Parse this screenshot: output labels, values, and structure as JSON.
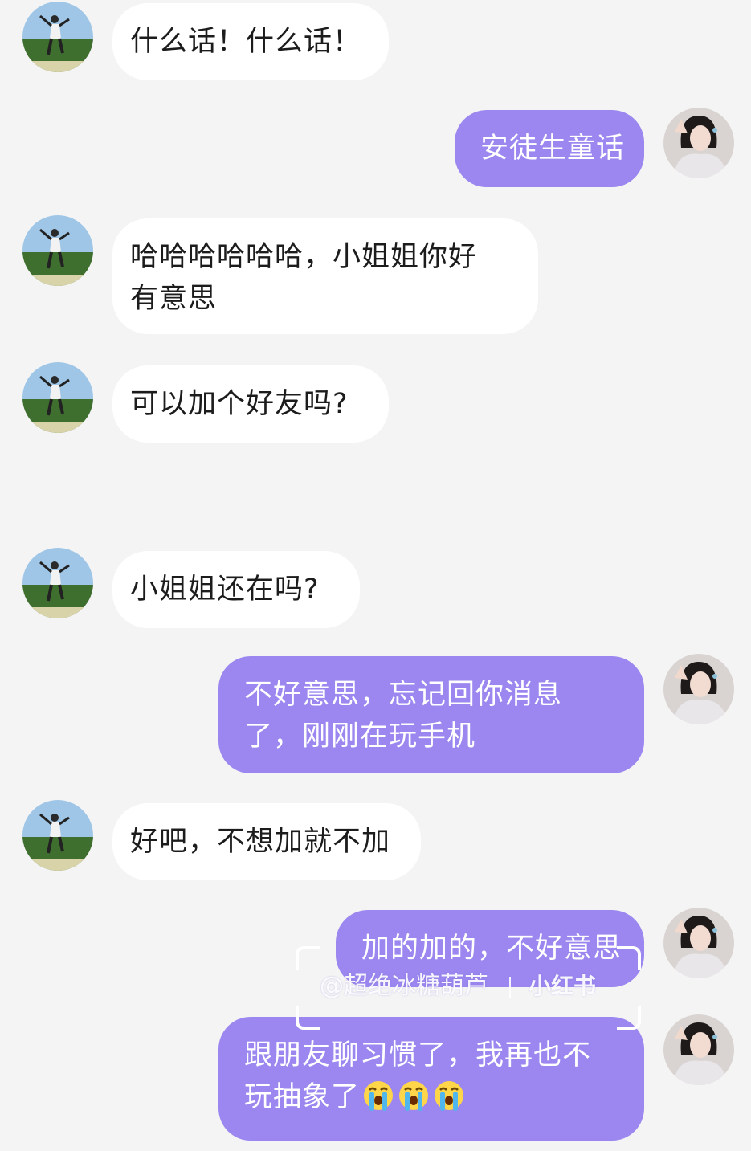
{
  "colors": {
    "background": "#f4f4f5",
    "incoming_bubble": "#ffffff",
    "outgoing_bubble": "#9b87ef",
    "incoming_text": "#1c1c1c",
    "outgoing_text": "#ffffff"
  },
  "messages": [
    {
      "sender": "other",
      "avatar_icon": "field-boy-avatar-icon",
      "text": "什么话！什么话！"
    },
    {
      "sender": "me",
      "avatar_icon": "girl-selfie-avatar-icon",
      "text": "安徒生童话"
    },
    {
      "sender": "other",
      "avatar_icon": "field-boy-avatar-icon",
      "text": "哈哈哈哈哈哈，小姐姐你好\n有意思"
    },
    {
      "sender": "other",
      "avatar_icon": "field-boy-avatar-icon",
      "text": "可以加个好友吗?"
    },
    {
      "sender": "other",
      "avatar_icon": "field-boy-avatar-icon",
      "text": "小姐姐还在吗?"
    },
    {
      "sender": "me",
      "avatar_icon": "girl-selfie-avatar-icon",
      "text": "不好意思，忘记回你消息\n了，刚刚在玩手机"
    },
    {
      "sender": "other",
      "avatar_icon": "field-boy-avatar-icon",
      "text": "好吧，不想加就不加"
    },
    {
      "sender": "me",
      "avatar_icon": "girl-selfie-avatar-icon",
      "text": "加的加的，不好意思"
    },
    {
      "sender": "me",
      "avatar_icon": "girl-selfie-avatar-icon",
      "text": "跟朋友聊习惯了，我再也不\n玩抽象了",
      "trailing_emoji": [
        "loudly-crying-emoji",
        "loudly-crying-emoji",
        "loudly-crying-emoji"
      ]
    }
  ],
  "watermark": {
    "handle": "@超绝冰糖葫芦",
    "brand": "小红书"
  }
}
